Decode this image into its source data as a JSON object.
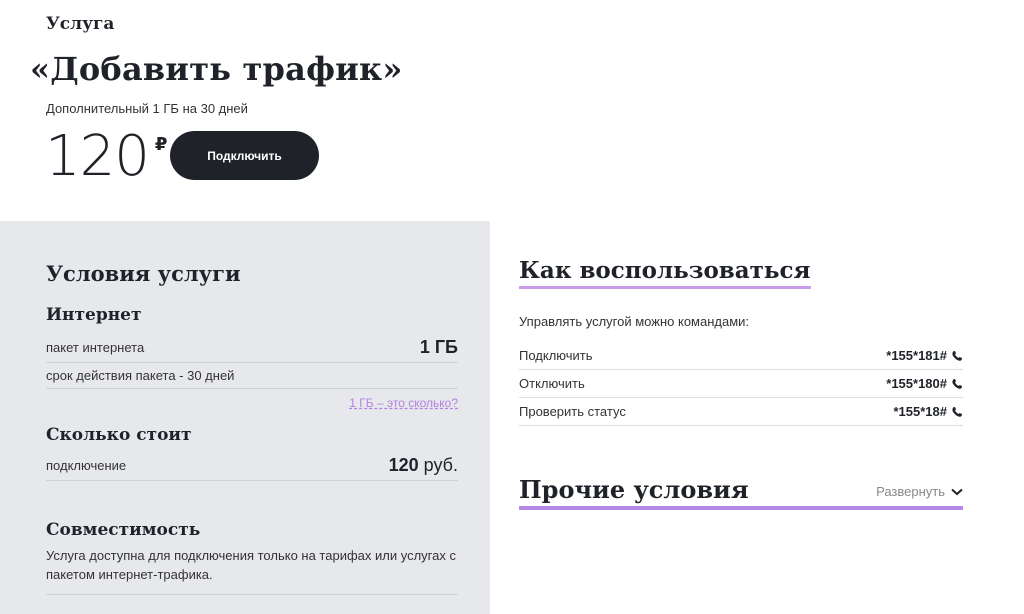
{
  "header": {
    "eyebrow": "Услуга",
    "title": "«Добавить трафик»",
    "subtitle": "Дополнительный 1 ГБ на 30 дней",
    "price": "120",
    "currency": "₽",
    "connect_label": "Подключить"
  },
  "conditions": {
    "heading": "Условия услуги",
    "internet": {
      "title": "Интернет",
      "rows": [
        {
          "label": "пакет интернета",
          "value": "1 ГБ"
        },
        {
          "label": "срок действия пакета - 30 дней",
          "value": ""
        }
      ],
      "link": "1 ГБ – это сколько?"
    },
    "cost": {
      "title": "Сколько стоит",
      "label": "подключение",
      "value": "120",
      "unit": "руб."
    },
    "compat": {
      "title": "Совместимость",
      "text": "Услуга доступна для подключения только на тарифах или услугах с пакетом интернет-трафика."
    }
  },
  "how": {
    "title": "Как воспользоваться",
    "manage_text": "Управлять услугой можно командами:",
    "commands": [
      {
        "label": "Подключить",
        "code": "*155*181#"
      },
      {
        "label": "Отключить",
        "code": "*155*180#"
      },
      {
        "label": "Проверить статус",
        "code": "*155*18#"
      }
    ]
  },
  "other": {
    "title": "Прочие условия",
    "expand_label": "Развернуть"
  },
  "colors": {
    "accent": "#b589e6",
    "dark": "#1f2228",
    "panel": "#e7e8ec"
  },
  "icons": {
    "phone": "phone-icon",
    "chevron": "chevron-down-icon"
  }
}
